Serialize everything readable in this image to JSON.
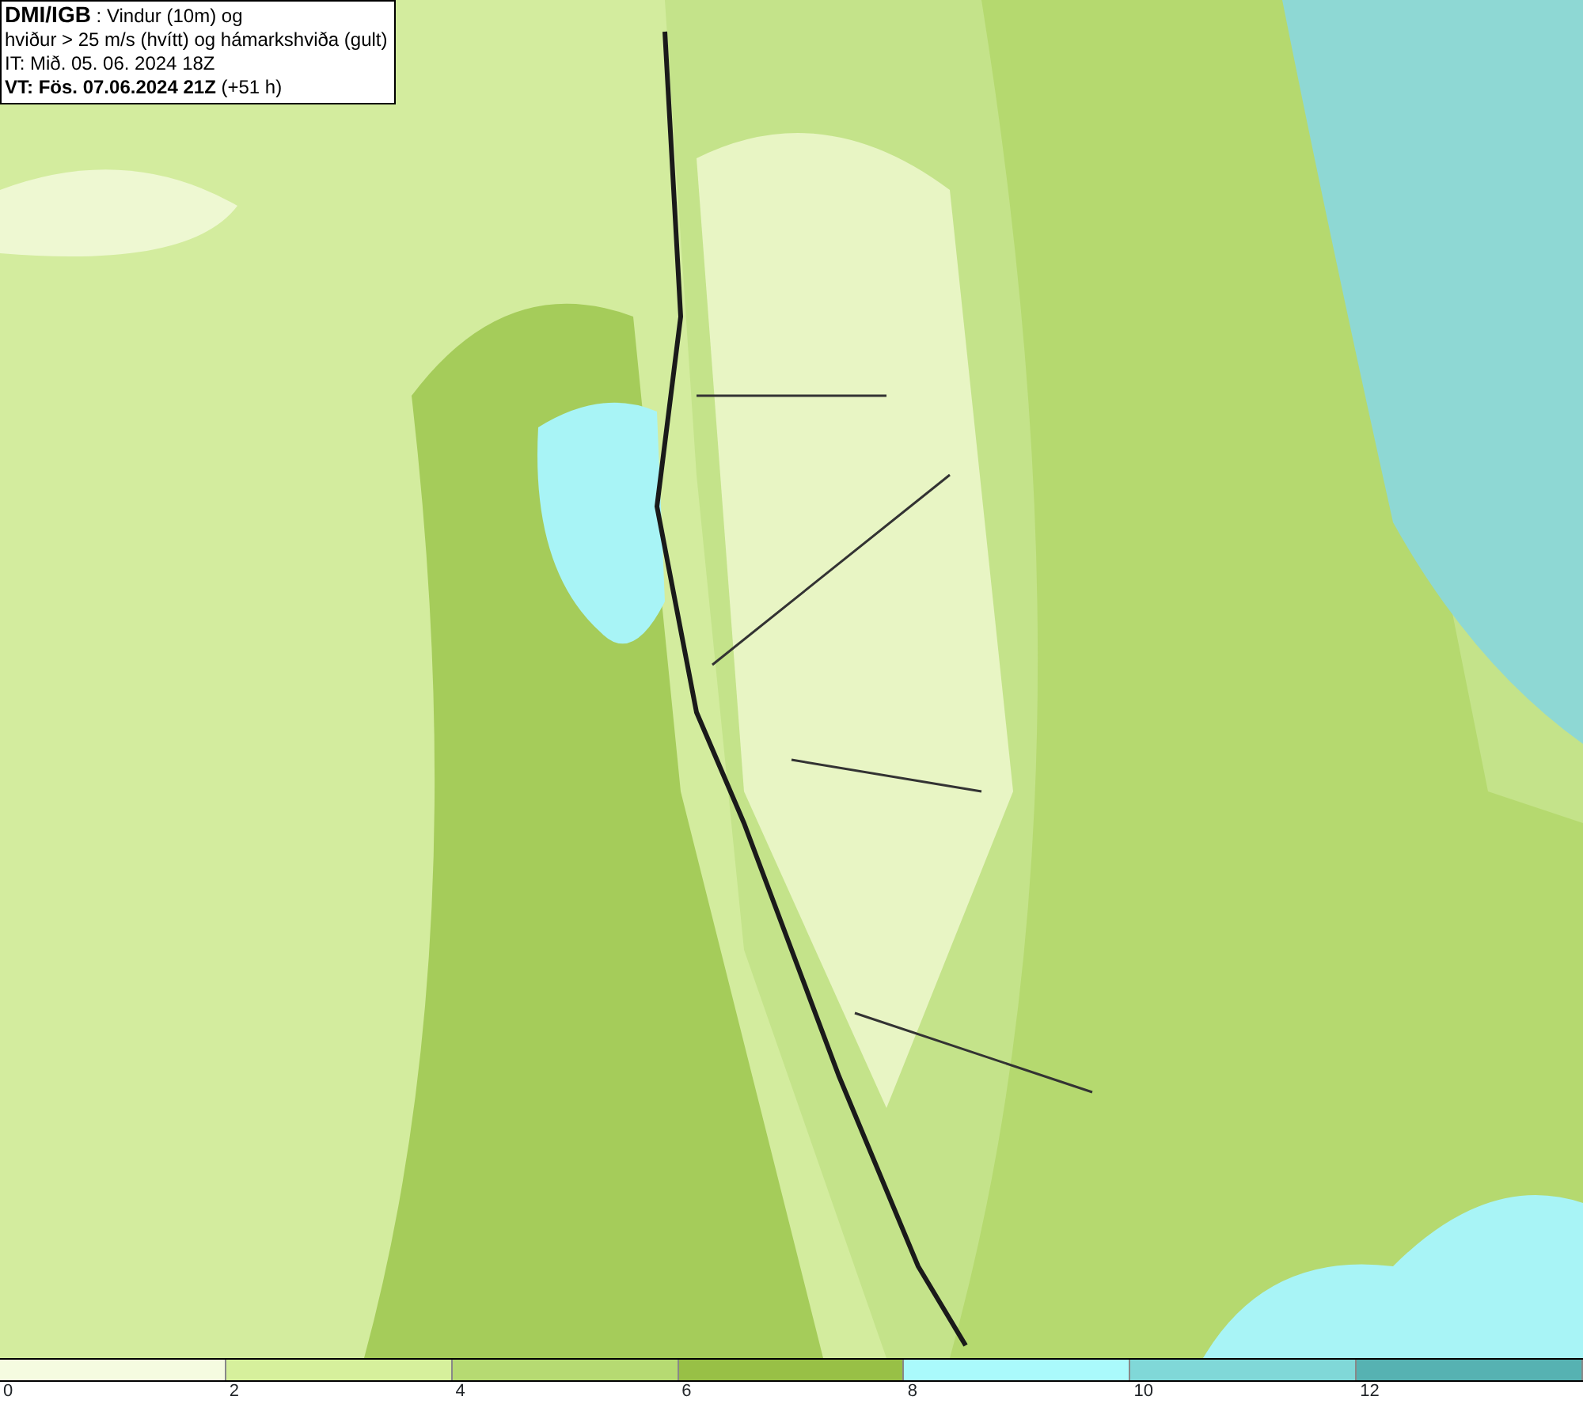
{
  "header_lines": [
    "**DMI/IGB** : Vindur (10m) og",
    "hviður > 25 m/s (hvítt) og hámarkshviða (gult)",
    "IT: Mið. 05. 06. 2024 18Z",
    "**VT: Fös. 07.06.2024 21Z** (+51 h)"
  ],
  "legend": {
    "bins": [
      {
        "color": "#f5fbe0"
      },
      {
        "color": "#d6f09c"
      },
      {
        "color": "#b6da72"
      },
      {
        "color": "#98c046"
      },
      {
        "color": "#aafafc"
      },
      {
        "color": "#80d8d8"
      },
      {
        "color": "#56b2b2"
      }
    ],
    "labels": [
      "0",
      "2",
      "4",
      "6",
      "8",
      "10",
      "12"
    ]
  }
}
